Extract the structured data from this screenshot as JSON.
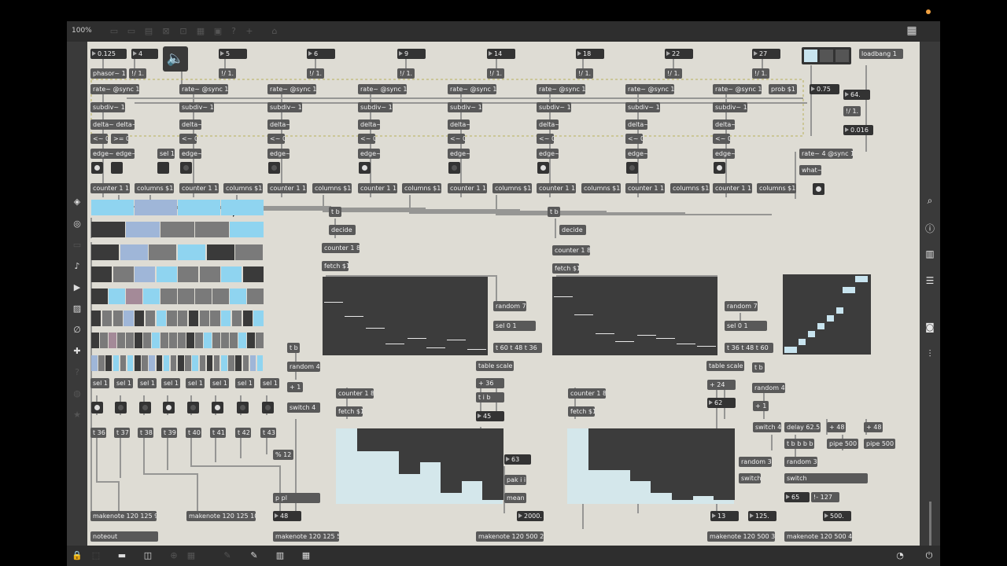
{
  "toolbar": {
    "zoom": "100%"
  },
  "lock_icon": "lock-icon",
  "objects": {
    "loadbang": "loadbang 1",
    "phasor": "phasor~ 1",
    "f1": "!/ 1.",
    "f2": "!/ 1.",
    "f3": "!/ 1.",
    "f4": "!/ 1.",
    "f5": "!/ 1.",
    "f6": "!/ 1.",
    "f7": "!/ 1.",
    "f8": "!/ 1.",
    "f9": "!/ 1.",
    "rate": "rate~ @sync 1",
    "subdiv": "subdiv~ 1",
    "delta": "delta~",
    "delta2": "delta~ delta~",
    "lt": "<~ 0",
    "ge": ">= 0",
    "edge": "edge~",
    "edge2": "edge~ edge~",
    "counter": "counter 1 1",
    "columns": "columns $1",
    "sel1": "sel 1",
    "prob": "prob $1",
    "rate4": "rate~ 4 @sync 1",
    "what": "what~",
    "f64": "!/ 1.",
    "tb": "t b",
    "decide": "decide",
    "counter18": "counter 1 8",
    "fetch": "fetch $1",
    "random7": "random 7",
    "sel01": "sel 0 1",
    "t1": "t 60  t 48  t 36",
    "t2": "t 36  t 48  t 60",
    "tablescale": "table scale",
    "random4": "random 4",
    "plus1": "+ 1",
    "switch4": "switch 4",
    "plus36": "+ 36",
    "tib": "t i b",
    "plus24": "+ 24",
    "delay": "delay 62.5",
    "plus48": "+ 48",
    "pipe500": "pipe 500",
    "tbbbb": "t b b b b",
    "random3": "random 3",
    "switch": "switch",
    "pak": "pak i i",
    "mean": "mean",
    "mod12": "% 12",
    "ppl": "p pl",
    "mk9": "makenote 120 125 9",
    "mk10": "makenote 120 125 10",
    "mk5": "makenote 120 125 5",
    "mk2": "makenote 120 500 2",
    "mk3": "makenote 120 500 3",
    "mk4": "makenote 120 500 4",
    "noteout": "noteout",
    "t127": "!- 127",
    "t36": "t 36",
    "t37": "t 37",
    "t38": "t 38",
    "t39": "t 39",
    "t40": "t 40",
    "t41": "t 41",
    "t42": "t 42",
    "t43": "t 43"
  },
  "numbers": {
    "n0125": "0.125",
    "n4": "4",
    "n5": "5",
    "n6": "6",
    "n9": "9",
    "n14": "14",
    "n18": "18",
    "n22": "22",
    "n27": "27",
    "n075": "0.75",
    "n64": "64.",
    "n0016": "0.016",
    "n45": "45",
    "n62": "62",
    "n63": "63",
    "n2000": "2000.",
    "n13": "13",
    "n125": "125.",
    "n65": "65",
    "n500": "500.",
    "n48": "48",
    "n8": "8"
  },
  "colors": {
    "canvas": "#dedcd4",
    "object": "#595959",
    "number": "#333333",
    "cyan": "#8fd4f0",
    "lightblue": "#9fb6d8",
    "gray": "#7a7a7a",
    "dark": "#3a3a3a",
    "panel": "#3c3c3c",
    "table": "#d4e7eb"
  },
  "matrix_rows": [
    [
      "cyan",
      "lightblue",
      "cyan",
      "cyan"
    ],
    [
      "dark",
      "lightblue",
      "gray",
      "gray",
      "cyan"
    ],
    [
      "dark",
      "lightblue",
      "gray",
      "cyan",
      "dark",
      "gray"
    ],
    [
      "dark",
      "gray",
      "lightblue",
      "cyan",
      "gray",
      "gray",
      "cyan",
      "dark"
    ],
    [
      "dark",
      "cyan",
      "pink",
      "cyan",
      "gray",
      "gray",
      "gray",
      "gray",
      "cyan",
      "gray"
    ],
    [
      "dark",
      "gray",
      "gray",
      "lightblue",
      "dark",
      "gray",
      "cyan",
      "gray",
      "gray",
      "dark",
      "gray",
      "gray",
      "cyan",
      "gray",
      "dark",
      "cyan"
    ],
    [
      "dark",
      "gray",
      "pink",
      "gray",
      "gray",
      "dark",
      "gray",
      "cyan",
      "gray",
      "gray",
      "gray",
      "dark",
      "gray",
      "cyan",
      "gray",
      "gray",
      "gray",
      "cyan",
      "dark",
      "gray"
    ],
    [
      "lightblue",
      "gray",
      "dark",
      "cyan",
      "gray",
      "cyan",
      "dark",
      "gray",
      "lightblue",
      "dark",
      "cyan",
      "gray",
      "dark",
      "gray",
      "cyan",
      "gray",
      "dark",
      "gray",
      "cyan",
      "gray",
      "dark",
      "gray",
      "lightblue",
      "cyan"
    ]
  ],
  "table_left": [
    0,
    0.3,
    0.3,
    0.6,
    0.45,
    0.85,
    0.7,
    0.95
  ],
  "table_right": [
    0,
    0.55,
    0.55,
    0.7,
    0.85,
    0.95,
    0.9,
    0.95
  ],
  "right_icons": [
    "search-icon",
    "info-icon",
    "book-icon",
    "list-icon",
    "camera-icon",
    "sliders-icon"
  ],
  "left_icons": [
    "cube-icon",
    "target-icon",
    "ruler-icon",
    "note-icon",
    "clip-icon",
    "image-icon",
    "paperclip-icon",
    "plugin-icon",
    "help-icon",
    "globe-icon",
    "star-icon"
  ]
}
